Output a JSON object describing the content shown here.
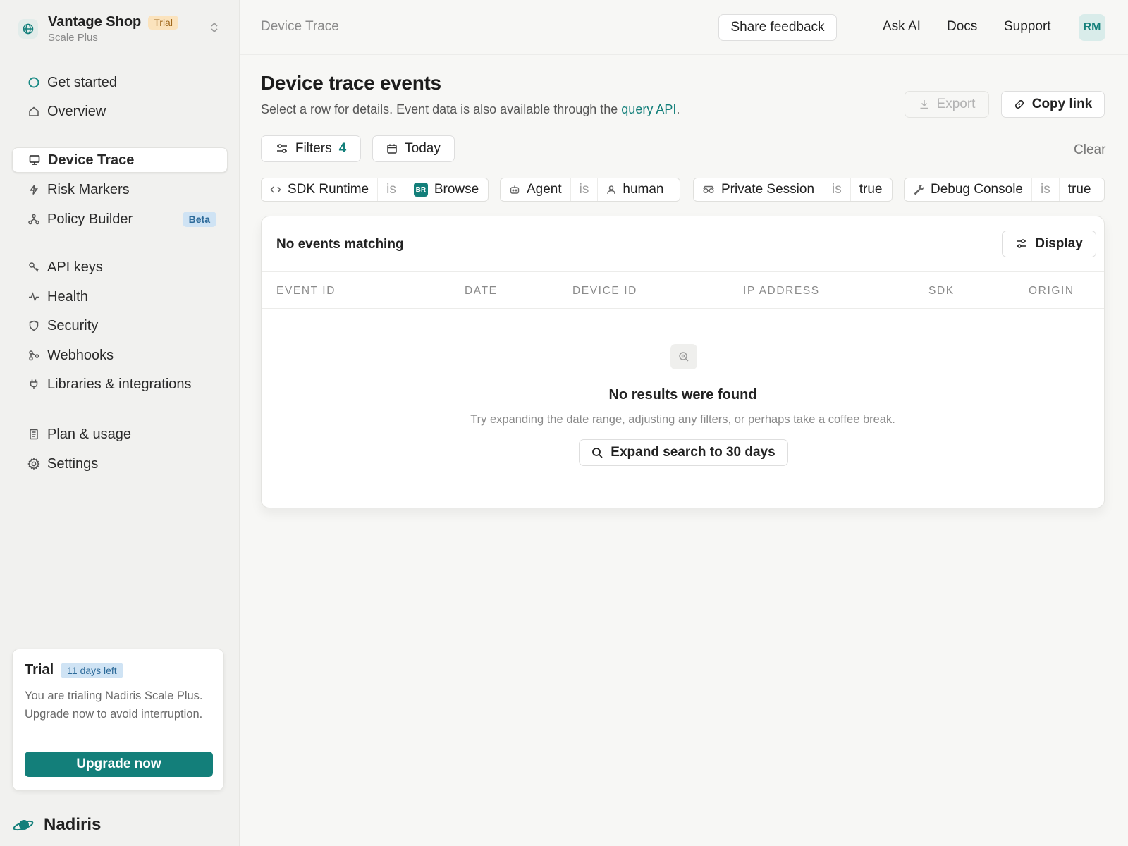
{
  "workspace": {
    "name": "Vantage Shop",
    "badge": "Trial",
    "plan": "Scale Plus"
  },
  "sidebar": {
    "items": [
      {
        "label": "Get started",
        "icon": "circle-icon"
      },
      {
        "label": "Overview",
        "icon": "home-icon"
      },
      {
        "label": "Device Trace",
        "icon": "monitor-icon",
        "active": true
      },
      {
        "label": "Risk Markers",
        "icon": "bolt-icon"
      },
      {
        "label": "Policy Builder",
        "icon": "flow-icon",
        "badge": "Beta"
      },
      {
        "label": "API keys",
        "icon": "key-icon"
      },
      {
        "label": "Health",
        "icon": "pulse-icon"
      },
      {
        "label": "Security",
        "icon": "shield-icon"
      },
      {
        "label": "Webhooks",
        "icon": "webhook-icon"
      },
      {
        "label": "Libraries & integrations",
        "icon": "plug-icon"
      },
      {
        "label": "Plan & usage",
        "icon": "document-icon"
      },
      {
        "label": "Settings",
        "icon": "gear-icon"
      }
    ]
  },
  "trial_card": {
    "title": "Trial",
    "days_left": "11 days left",
    "body": "You are trialing Nadiris Scale Plus. Upgrade now to avoid interruption.",
    "cta": "Upgrade now"
  },
  "brand": {
    "name": "Nadiris"
  },
  "topbar": {
    "breadcrumb": "Device Trace",
    "feedback": "Share feedback",
    "links": [
      "Ask AI",
      "Docs",
      "Support"
    ],
    "avatar_initials": "RM"
  },
  "page": {
    "title": "Device trace events",
    "subtitle_prefix": "Select a row for details. Event data is also available through the ",
    "subtitle_link": "query API",
    "subtitle_suffix": ".",
    "export_label": "Export",
    "copy_link_label": "Copy link",
    "filters_label": "Filters",
    "filters_count": "4",
    "date_label": "Today",
    "clear_label": "Clear"
  },
  "filter_chips": [
    {
      "field": "SDK Runtime",
      "op": "is",
      "value": "Browse",
      "value_badge": "BR"
    },
    {
      "field": "Agent",
      "op": "is",
      "value": "human"
    },
    {
      "field": "Private Session",
      "op": "is",
      "value": "true"
    },
    {
      "field": "Debug Console",
      "op": "is",
      "value": "true"
    }
  ],
  "results": {
    "header_title": "No events matching",
    "display_label": "Display",
    "columns": [
      "EVENT ID",
      "DATE",
      "DEVICE ID",
      "IP ADDRESS",
      "SDK",
      "ORIGIN"
    ],
    "empty_title": "No results were found",
    "empty_subtitle": "Try expanding the date range, adjusting any filters, or perhaps take a coffee break.",
    "expand_label": "Expand search to 30 days"
  },
  "colors": {
    "accent": "#137f7a",
    "trial_badge_bg": "#fbe3bd",
    "beta_badge_bg": "#cfe3f4"
  }
}
